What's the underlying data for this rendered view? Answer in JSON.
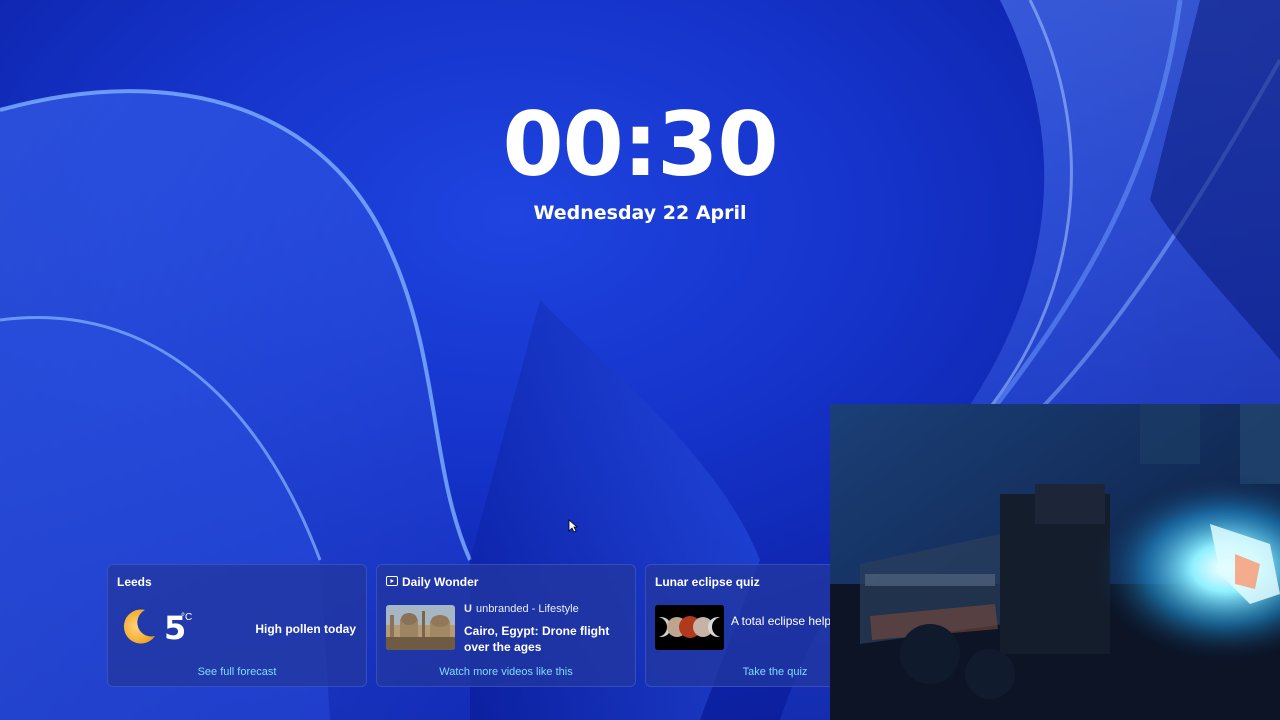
{
  "lockscreen": {
    "time": "00:30",
    "date": "Wednesday 22 April"
  },
  "widgets": {
    "weather": {
      "title": "Leeds",
      "temperature": "5",
      "unit": "°C",
      "condition_icon": "moon-icon",
      "alert": "High pollen today",
      "link": "See full forecast"
    },
    "daily_wonder": {
      "title": "Daily Wonder",
      "title_icon": "video-icon",
      "source_mark": "U",
      "source": "unbranded - Lifestyle",
      "headline": "Cairo, Egypt: Drone flight over the ages",
      "link": "Watch more videos like this"
    },
    "eclipse_quiz": {
      "title": "Lunar eclipse quiz",
      "text": "A total eclipse help famous explorer su",
      "link": "Take the quiz"
    }
  },
  "colors": {
    "link": "#7fdcff",
    "card_bg": "#2337a0",
    "wallpaper": "#1533c9"
  }
}
